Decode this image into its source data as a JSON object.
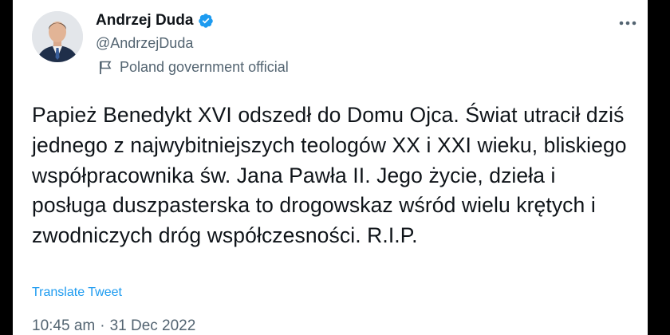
{
  "author": {
    "display_name": "Andrzej Duda",
    "handle": "@AndrzejDuda",
    "label": "Poland government official",
    "verified_icon": "verified-badge-icon",
    "label_icon": "flag-icon"
  },
  "tweet": {
    "text": "Papież Benedykt XVI odszedł do Domu Ojca. Świat utracił dziś jednego z najwybitniejszych teologów XX i XXI wieku, bliskiego współpracownika św. Jana Pawła II. Jego życie, dzieła i posługa duszpasterska to drogowskaz wśród wielu krętych i zwodniczych dróg współczesności. R.I.P.",
    "translate_label": "Translate Tweet",
    "time": "10:45 am",
    "separator": "·",
    "date": "31 Dec 2022"
  },
  "colors": {
    "verified": "#1d9bf0",
    "link": "#1d9bf0",
    "text": "#0f1419",
    "secondary": "#536471"
  },
  "menu": {
    "more_icon": "more-options-icon"
  }
}
